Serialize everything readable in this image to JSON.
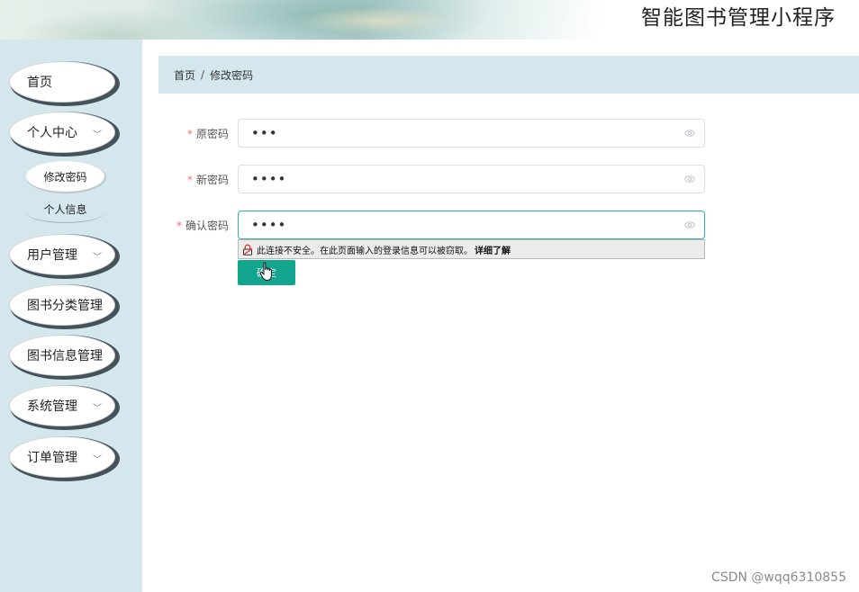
{
  "header": {
    "app_title": "智能图书管理小程序"
  },
  "sidebar": {
    "home": "首页",
    "personal_center": "个人中心",
    "change_password": "修改密码",
    "personal_info": "个人信息",
    "user_mgmt": "用户管理",
    "category_mgmt": "图书分类管理",
    "book_info_mgmt": "图书信息管理",
    "system_mgmt": "系统管理",
    "order_mgmt": "订单管理",
    "chevron": "﹀"
  },
  "breadcrumb": {
    "home": "首页",
    "separator": "/",
    "current": "修改密码"
  },
  "form": {
    "required_mark": "*",
    "old_password": {
      "label": "原密码",
      "value": "•••"
    },
    "new_password": {
      "label": "新密码",
      "value": "••••"
    },
    "confirm_password": {
      "label": "确认密码",
      "value": "••••"
    },
    "confirm_button": "确定"
  },
  "security_warning": {
    "text": "此连接不安全。在此页面输入的登录信息可以被窃取。",
    "learn_more": "详细了解"
  },
  "watermark": "CSDN @wqq6310855",
  "colors": {
    "accent": "#14a58e",
    "sidebar_bg": "#d4e7ec",
    "required": "#f56c6c"
  }
}
